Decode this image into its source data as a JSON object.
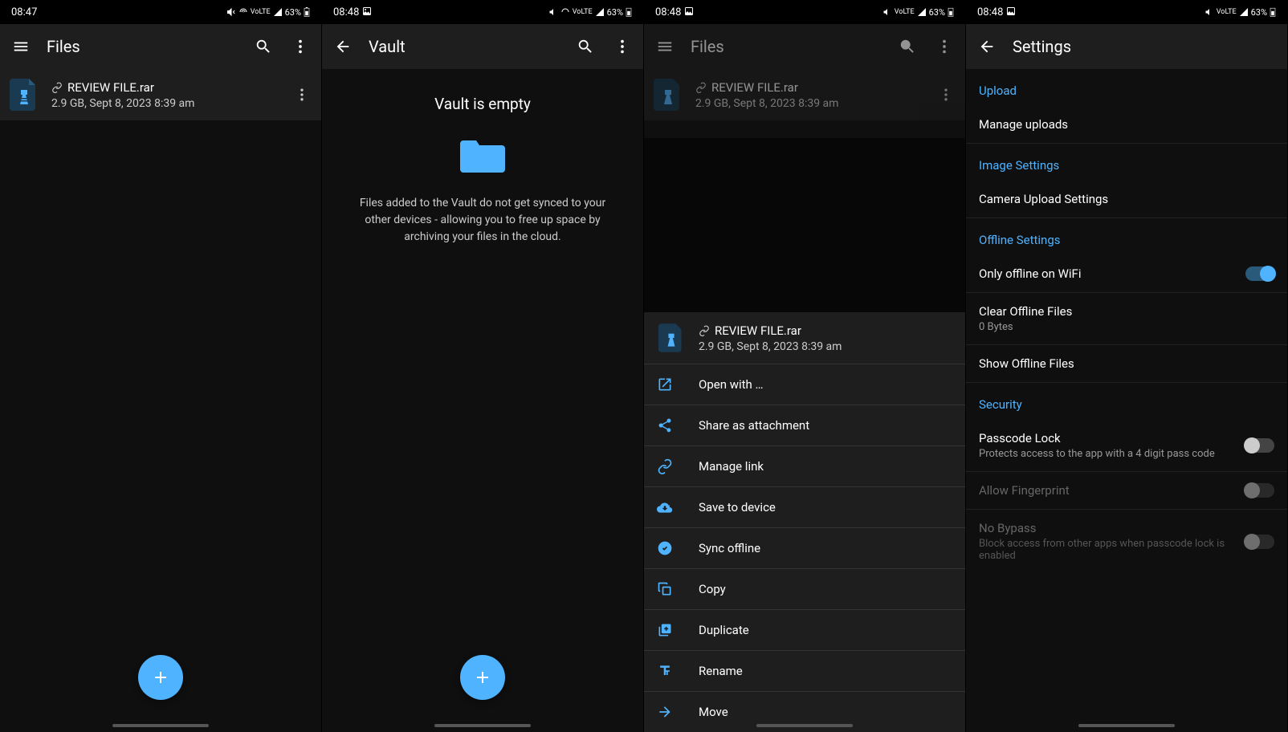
{
  "status": {
    "times": [
      "08:47",
      "08:48",
      "08:48",
      "08:48"
    ],
    "battery": "63%"
  },
  "screens": {
    "files": {
      "title": "Files",
      "file": {
        "name": "REVIEW FILE.rar",
        "meta": "2.9 GB, Sept 8, 2023 8:39 am"
      }
    },
    "vault": {
      "title": "Vault",
      "emptyTitle": "Vault is empty",
      "emptyDesc": "Files added to the Vault do not get synced to your other devices - allowing you to free up space by archiving your files in the cloud."
    },
    "sheet": {
      "title": "Files",
      "file": {
        "name": "REVIEW FILE.rar",
        "meta": "2.9 GB, Sept 8, 2023 8:39 am"
      },
      "sheetFile": {
        "name": "REVIEW FILE.rar",
        "meta": "2.9 GB, Sept 8, 2023 8:39 am"
      },
      "actions": {
        "openWith": "Open with …",
        "share": "Share as attachment",
        "manageLink": "Manage link",
        "saveDevice": "Save to device",
        "syncOffline": "Sync offline",
        "copy": "Copy",
        "duplicate": "Duplicate",
        "rename": "Rename",
        "move": "Move"
      }
    },
    "settings": {
      "title": "Settings",
      "sections": {
        "upload": "Upload",
        "image": "Image Settings",
        "offline": "Offline Settings",
        "security": "Security"
      },
      "items": {
        "manageUploads": "Manage uploads",
        "cameraUpload": "Camera Upload Settings",
        "onlyWifi": "Only offline on WiFi",
        "clearOffline": "Clear Offline Files",
        "clearOfflineSub": "0 Bytes",
        "showOffline": "Show Offline Files",
        "passcode": "Passcode Lock",
        "passcodeSub": "Protects access to the app with a 4 digit pass code",
        "fingerprint": "Allow Fingerprint",
        "noBypass": "No Bypass",
        "noBypassSub": "Block access from other apps when passcode lock is enabled"
      }
    }
  }
}
